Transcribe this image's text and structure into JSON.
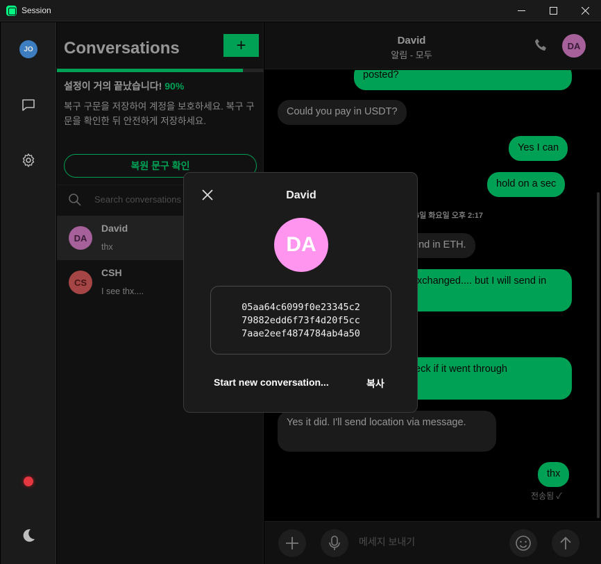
{
  "window": {
    "title": "Session",
    "controls": {
      "minimize": "—",
      "maximize": "☐",
      "close": "✕"
    }
  },
  "rail": {
    "avatar_initials": "JO",
    "items": [
      "chat-bubble-icon",
      "gear-icon",
      "status-dot",
      "moon-icon"
    ]
  },
  "left_panel": {
    "title": "Conversations",
    "new_button": "+",
    "progress_percent": 90,
    "setup_title": "설정이 거의 끝났습니다!",
    "setup_percent": "90%",
    "setup_desc": "복구 구문을 저장하여 계정을 보호하세요. 복구 구문을 확인한 뒤 안전하게 저장하세요.",
    "verify_button": "복원 문구 확인",
    "search_placeholder": "Search conversations",
    "conversations": [
      {
        "initials": "DA",
        "name": "David",
        "preview": "thx",
        "avatar_color": "#ff95ef"
      },
      {
        "initials": "CS",
        "name": "CSH",
        "preview": "I see thx....",
        "avatar_color": "#ff6b6b"
      }
    ]
  },
  "chat": {
    "contact_name": "David",
    "subtitle": "알림 - 모두",
    "avatar_initials": "DA",
    "messages": [
      {
        "dir": "out",
        "text": "posted?"
      },
      {
        "dir": "in",
        "text": "Could you pay in USDT?"
      },
      {
        "dir": "out",
        "text": "Yes I can"
      },
      {
        "dir": "out",
        "text": "hold on a sec"
      },
      {
        "dir": "in",
        "text": "end in ETH."
      },
      {
        "dir": "out",
        "text": "xchanged.... but I will send in"
      },
      {
        "dir": "out",
        "text": "eck if it went through"
      },
      {
        "dir": "in",
        "text": "Yes it did. I'll send location via message."
      },
      {
        "dir": "out",
        "text": "thx"
      }
    ],
    "timestamp": "6일 화요일 오후 2:17",
    "status": "전송됨 ✓",
    "composer_placeholder": "메세지 보내기"
  },
  "modal": {
    "title": "David",
    "avatar_initials": "DA",
    "session_id_lines": [
      "05aa64c6099f0e23345c2",
      "79882edd6f73f4d20f5cc",
      "7aae2eef4874784ab4a50"
    ],
    "start_button": "Start new conversation...",
    "copy_button": "복사"
  },
  "colors": {
    "accent": "#00f782",
    "avatar_pink": "#ff95ef",
    "avatar_red": "#ff6b6b",
    "status_red": "#e5373f"
  }
}
